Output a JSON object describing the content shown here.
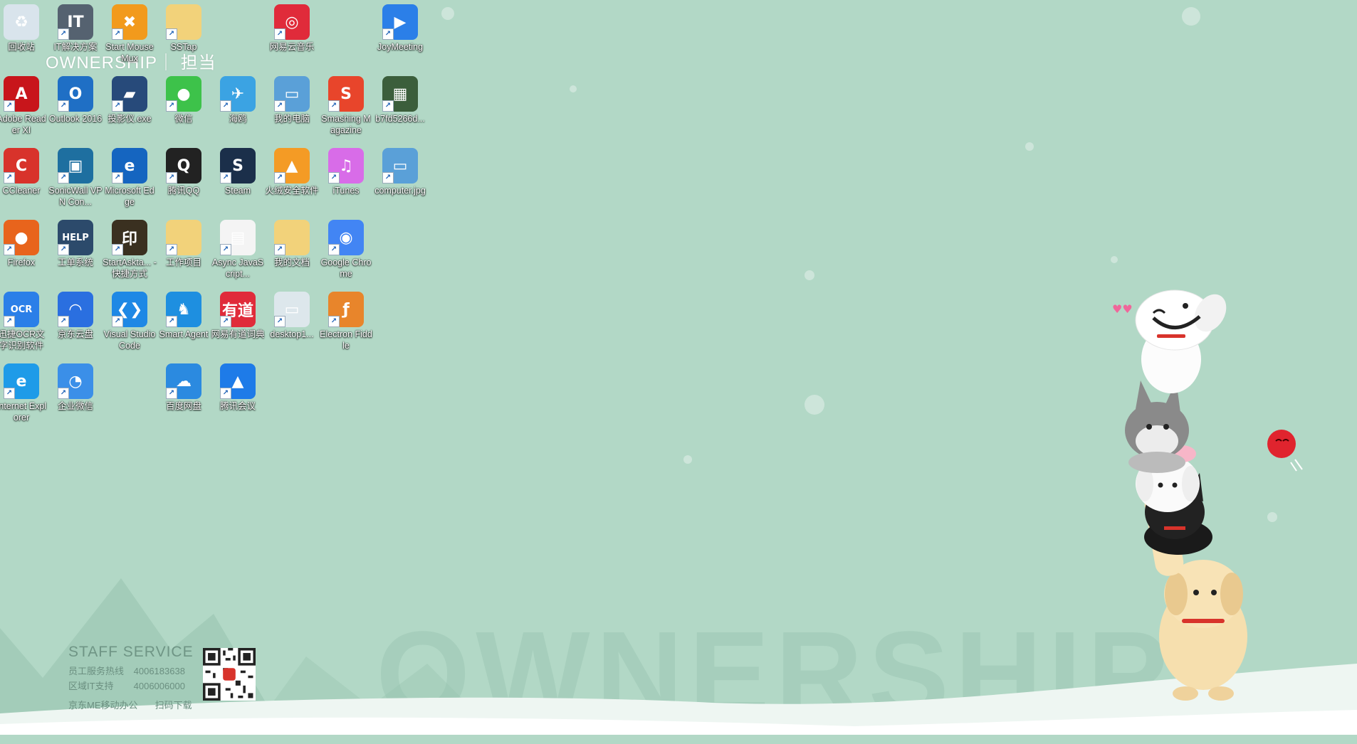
{
  "desktop": {
    "top_banner": "OWNERSHIP｜ 担当",
    "watermark": "OWNERSHIP",
    "staff_service": {
      "title": "STAFF SERVICE",
      "hotline_label": "员工服务热线",
      "hotline_number": "4006183638",
      "it_label": "区域IT支持",
      "it_number": "4006006000",
      "app_label": "京东ME移动办公",
      "scan_label": "扫码下载"
    }
  },
  "icons": [
    {
      "label": "回收站",
      "glyph": "♻",
      "color": "#d9e4ec",
      "icon": "recycle-bin-icon"
    },
    {
      "label": "IT解决方案",
      "glyph": "IT",
      "color": "#556270",
      "icon": "it-tool-icon"
    },
    {
      "label": "Start MouseMux",
      "glyph": "✖",
      "color": "#f29a1c",
      "icon": "mousemux-icon"
    },
    {
      "label": "SSTap",
      "glyph": "",
      "color": "#f2d27a",
      "icon": "folder-icon"
    },
    {
      "label": "网易云音乐",
      "glyph": "◎",
      "color": "#e02b3a",
      "icon": "netease-music-icon"
    },
    {
      "label": "JoyMeeting",
      "glyph": "▶",
      "color": "#2b7fe8",
      "icon": "joymeeting-icon"
    },
    {
      "label": "Adobe Reader XI",
      "glyph": "A",
      "color": "#c8151b",
      "icon": "adobe-reader-icon"
    },
    {
      "label": "Outlook 2016",
      "glyph": "O",
      "color": "#1f6fc5",
      "icon": "outlook-icon"
    },
    {
      "label": "投影仪.exe",
      "glyph": "▰",
      "color": "#274a7a",
      "icon": "projector-icon"
    },
    {
      "label": "微信",
      "glyph": "●",
      "color": "#3dc24a",
      "icon": "wechat-icon"
    },
    {
      "label": "海鸥",
      "glyph": "✈",
      "color": "#3ba3e3",
      "icon": "seagull-icon"
    },
    {
      "label": "我的电脑",
      "glyph": "▭",
      "color": "#5aa0d8",
      "icon": "my-computer-icon"
    },
    {
      "label": "Smashing Magazine",
      "glyph": "S",
      "color": "#e8452b",
      "icon": "smashing-magazine-icon"
    },
    {
      "label": "b7fd5266d...",
      "glyph": "▦",
      "color": "#3b5e3b",
      "icon": "image-file-icon"
    },
    {
      "label": "CCleaner",
      "glyph": "C",
      "color": "#d8332b",
      "icon": "ccleaner-icon"
    },
    {
      "label": "SonicWall VPN Con...",
      "glyph": "▣",
      "color": "#1e6fa0",
      "icon": "sonicwall-vpn-icon"
    },
    {
      "label": "Microsoft Edge",
      "glyph": "e",
      "color": "#1565c0",
      "icon": "edge-legacy-icon"
    },
    {
      "label": "腾讯QQ",
      "glyph": "Q",
      "color": "#222222",
      "icon": "qq-icon"
    },
    {
      "label": "Steam",
      "glyph": "S",
      "color": "#1b2f4a",
      "icon": "steam-icon"
    },
    {
      "label": "火绒安全软件",
      "glyph": "▲",
      "color": "#f49b25",
      "icon": "huorong-icon"
    },
    {
      "label": "iTunes",
      "glyph": "♫",
      "color": "#d86ce8",
      "icon": "itunes-icon"
    },
    {
      "label": "computer.jpg",
      "glyph": "▭",
      "color": "#5aa0d8",
      "icon": "computer-image-icon"
    },
    {
      "label": "Firefox",
      "glyph": "●",
      "color": "#e8641c",
      "icon": "firefox-icon"
    },
    {
      "label": "工单系统",
      "glyph": "HELP",
      "color": "#2c4a6b",
      "icon": "help-sign-icon"
    },
    {
      "label": "StartAskta... - 快捷方式",
      "glyph": "印",
      "color": "#3a3020",
      "icon": "startaskta-icon"
    },
    {
      "label": "工作项目",
      "glyph": "",
      "color": "#f2d27a",
      "icon": "work-folder-icon"
    },
    {
      "label": "Async JavaScript...",
      "glyph": "▤",
      "color": "#f4f4f4",
      "icon": "book-icon"
    },
    {
      "label": "我的文档",
      "glyph": "",
      "color": "#f2d27a",
      "icon": "documents-folder-icon"
    },
    {
      "label": "Google Chrome",
      "glyph": "◉",
      "color": "#4285f4",
      "icon": "chrome-icon"
    },
    {
      "label": "迅捷OCR文字识别软件",
      "glyph": "OCR",
      "color": "#2b7fe8",
      "icon": "ocr-icon"
    },
    {
      "label": "京东云盘",
      "glyph": "◠",
      "color": "#2a6fe0",
      "icon": "jd-cloud-icon"
    },
    {
      "label": "Visual Studio Code",
      "glyph": "❮❯",
      "color": "#1e88e5",
      "icon": "vscode-icon"
    },
    {
      "label": "Smart Agent",
      "glyph": "♞",
      "color": "#1e8fe0",
      "icon": "smart-agent-icon"
    },
    {
      "label": "网易有道词典",
      "glyph": "有道",
      "color": "#e02b3a",
      "icon": "youdao-dict-icon"
    },
    {
      "label": "desktop1...",
      "glyph": "▭",
      "color": "#dde7ec",
      "icon": "desktop-image-icon"
    },
    {
      "label": "Electron Fiddle",
      "glyph": "ƒ",
      "color": "#e8852b",
      "icon": "electron-fiddle-icon"
    },
    {
      "label": "Internet Explorer",
      "glyph": "e",
      "color": "#1e9be8",
      "icon": "ie-icon"
    },
    {
      "label": "企业微信",
      "glyph": "◔",
      "color": "#3b8fe8",
      "icon": "wecom-icon"
    },
    {
      "label": "百度网盘",
      "glyph": "☁",
      "color": "#2b8ae0",
      "icon": "baidu-netdisk-icon"
    },
    {
      "label": "腾讯会议",
      "glyph": "▲",
      "color": "#1e7be8",
      "icon": "tencent-meeting-icon"
    }
  ]
}
